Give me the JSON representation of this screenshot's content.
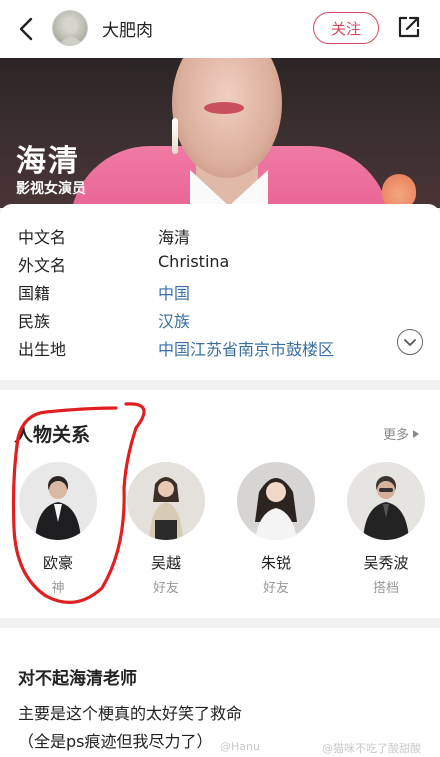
{
  "topbar": {
    "username": "大肥肉",
    "follow_label": "关注"
  },
  "hero": {
    "name": "海清",
    "role": "影视女演员"
  },
  "info": {
    "rows": [
      {
        "label": "中文名",
        "value": "海清",
        "link": false
      },
      {
        "label": "外文名",
        "value": "Christina",
        "link": false
      },
      {
        "label": "国籍",
        "value": "中国",
        "link": true
      },
      {
        "label": "民族",
        "value": "汉族",
        "link": true
      },
      {
        "label": "出生地",
        "value": "中国江苏省南京市鼓楼区",
        "link": true
      }
    ]
  },
  "relations": {
    "title": "人物关系",
    "more_label": "更多",
    "people": [
      {
        "name": "欧豪",
        "relation": "神"
      },
      {
        "name": "吴越",
        "relation": "好友"
      },
      {
        "name": "朱锐",
        "relation": "好友"
      },
      {
        "name": "吴秀波",
        "relation": "搭档"
      }
    ]
  },
  "post": {
    "title": "对不起海清老师",
    "lines": [
      "主要是这个梗真的太好笑了救命",
      "（全是ps痕迹但我尽力了）"
    ]
  },
  "watermarks": {
    "left": "@Hanu",
    "right": "@猫咪不吃了酸甜酸"
  },
  "colors": {
    "accent": "#d8485c",
    "link": "#3a6fa3",
    "annotation": "#e02020"
  }
}
